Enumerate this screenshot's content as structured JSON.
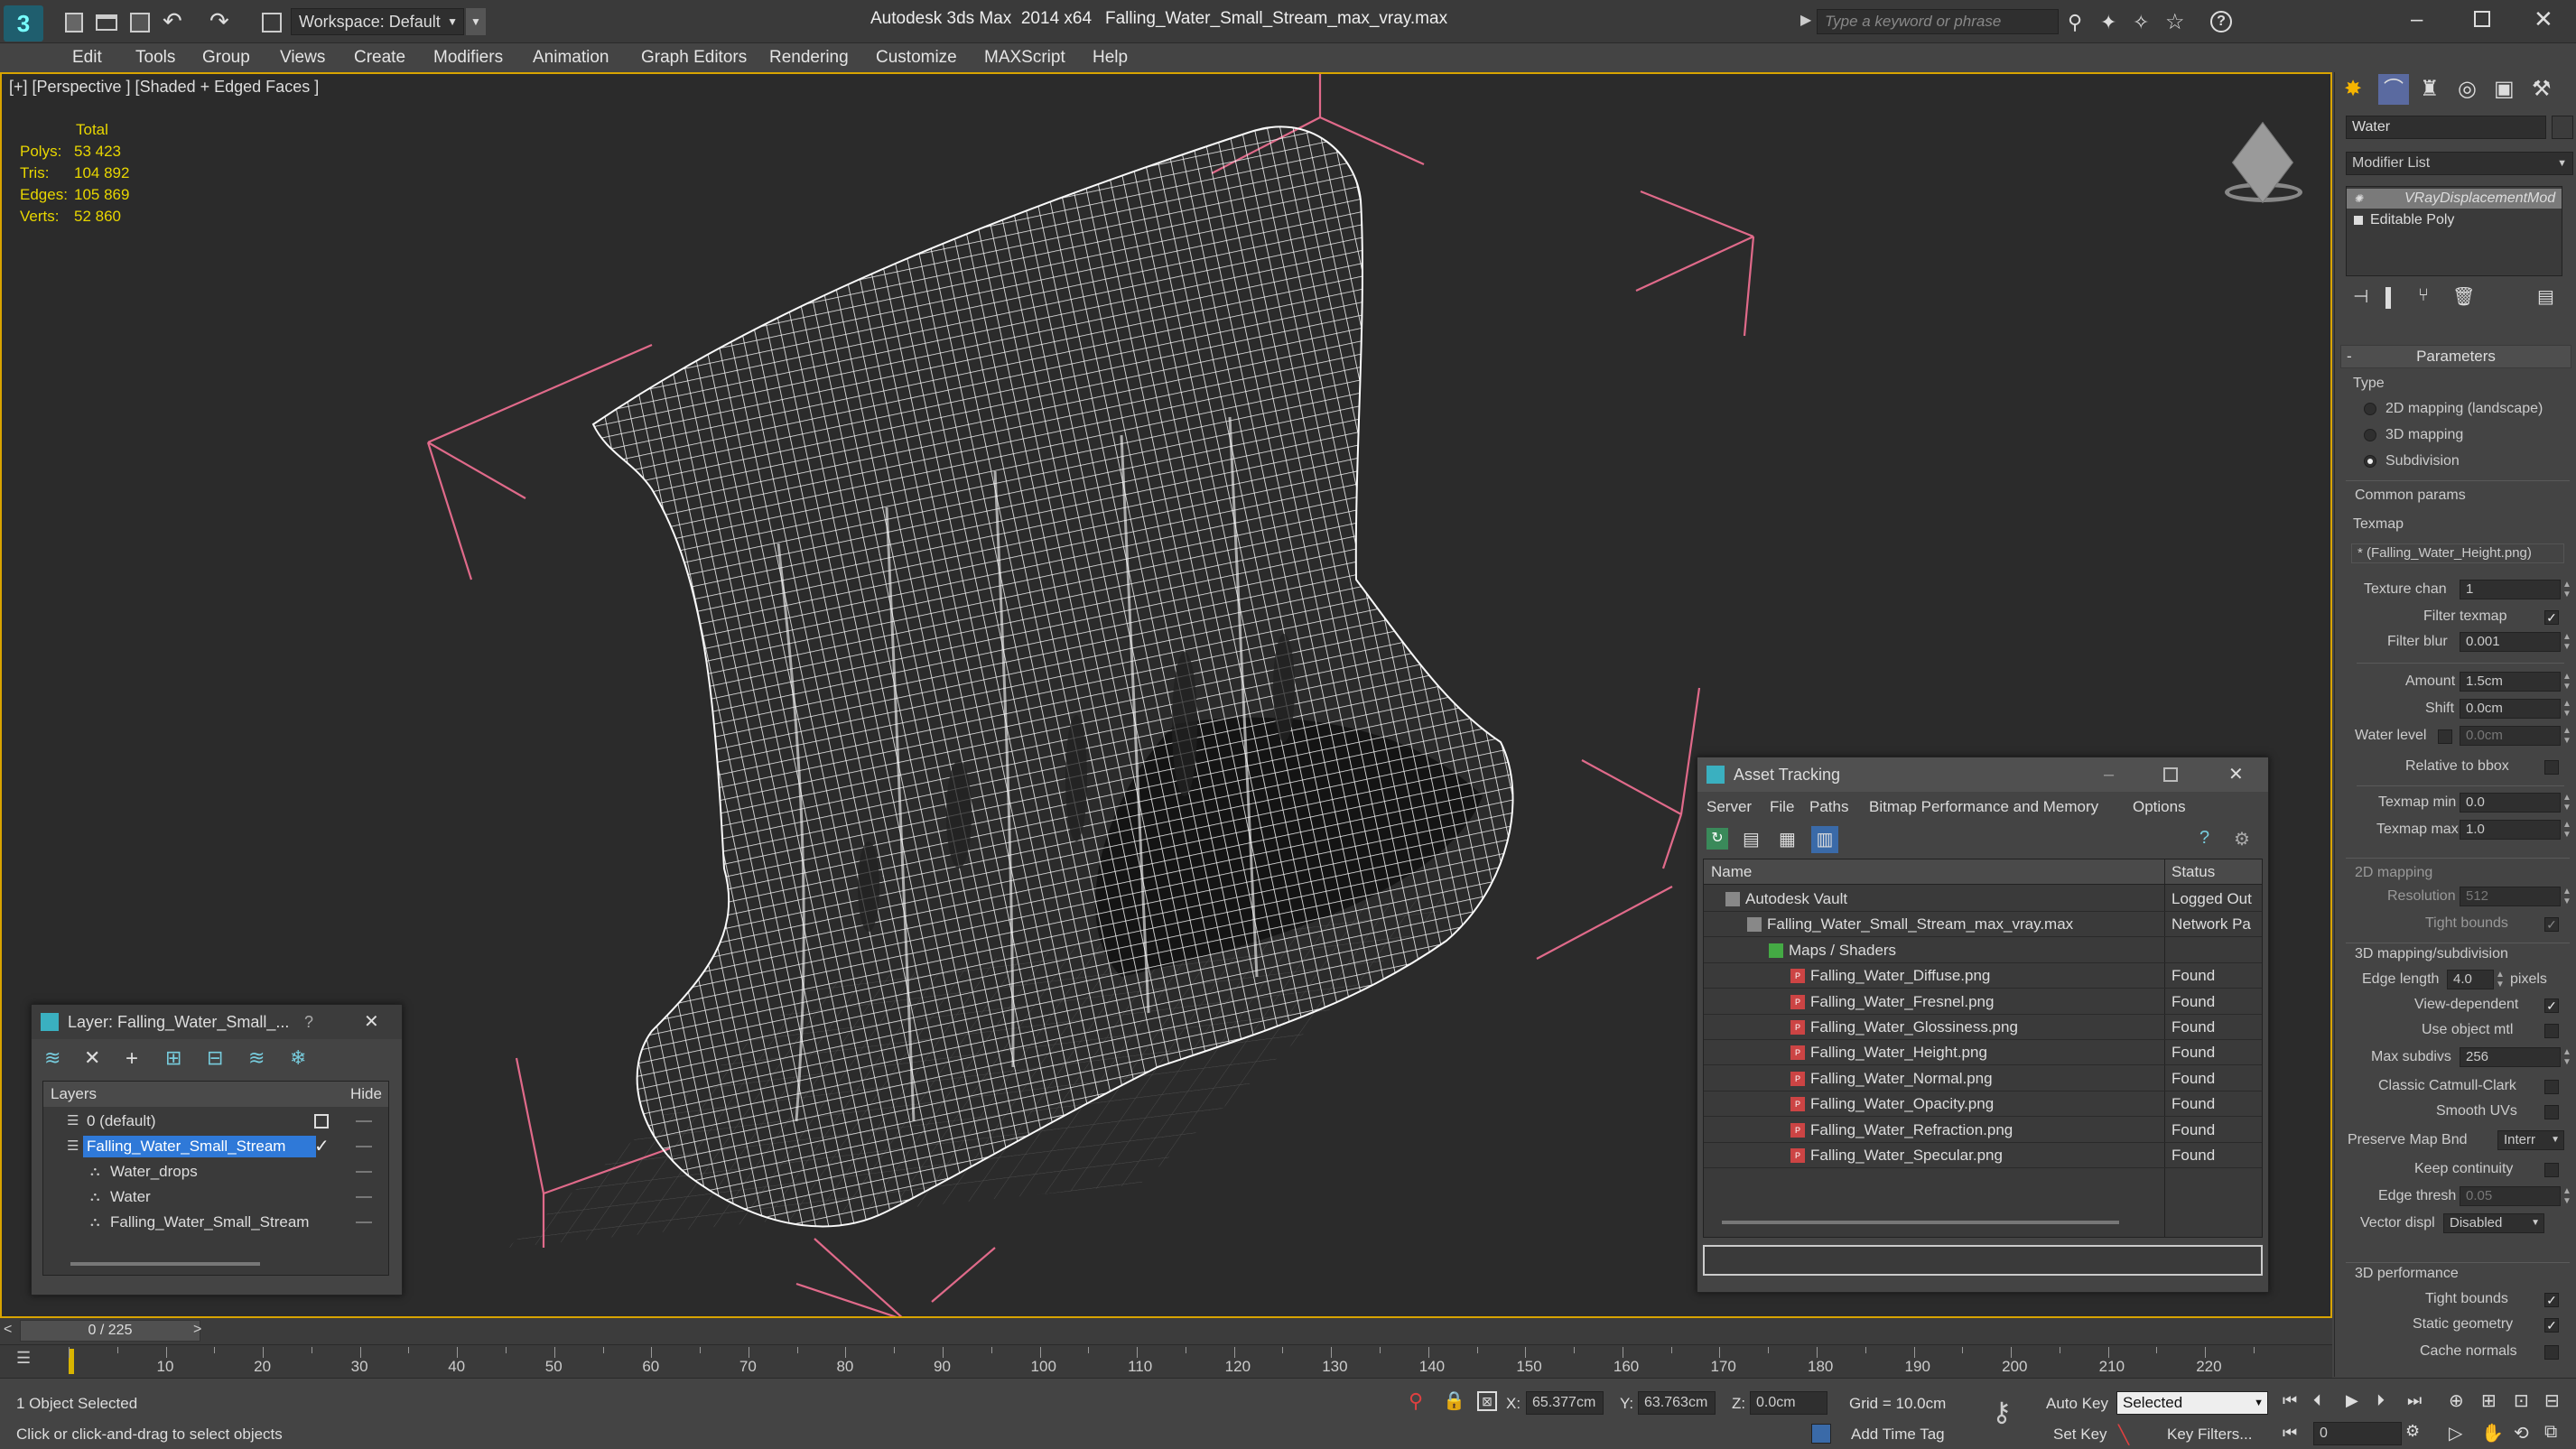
{
  "titlebar": {
    "workspace": "Workspace: Default",
    "app_title": "Autodesk 3ds Max  2014 x64",
    "file_title": "Falling_Water_Small_Stream_max_vray.max",
    "search_placeholder": "Type a keyword or phrase"
  },
  "menu": [
    "Edit",
    "Tools",
    "Group",
    "Views",
    "Create",
    "Modifiers",
    "Animation",
    "Graph Editors",
    "Rendering",
    "Customize",
    "MAXScript",
    "Help"
  ],
  "viewport": {
    "label": "[+] [Perspective ] [Shaded + Edged Faces ]",
    "stats_header": "Total",
    "stats": [
      {
        "k": "Polys:",
        "v": "53 423"
      },
      {
        "k": "Tris:",
        "v": "104 892"
      },
      {
        "k": "Edges:",
        "v": "105 869"
      },
      {
        "k": "Verts:",
        "v": "52 860"
      }
    ]
  },
  "command_panel": {
    "object_name": "Water",
    "modifier_list": "Modifier List",
    "stack": [
      "VRayDisplacementMod",
      "Editable Poly"
    ],
    "rollout_title": "Parameters",
    "type_label": "Type",
    "type_options": [
      {
        "label": "2D mapping (landscape)",
        "on": false
      },
      {
        "label": "3D mapping",
        "on": false
      },
      {
        "label": "Subdivision",
        "on": true
      }
    ],
    "common_params": "Common params",
    "texmap_label": "Texmap",
    "texmap_value": "* (Falling_Water_Height.png)",
    "texture_chan_label": "Texture chan",
    "texture_chan": "1",
    "filter_texmap": "Filter texmap",
    "filter_blur_label": "Filter blur",
    "filter_blur": "0.001",
    "amount_label": "Amount",
    "amount": "1.5cm",
    "shift_label": "Shift",
    "shift": "0.0cm",
    "water_level_label": "Water level",
    "water_level": "0.0cm",
    "relative_bbox": "Relative to bbox",
    "texmap_min_label": "Texmap min",
    "texmap_min": "0.0",
    "texmap_max_label": "Texmap max",
    "texmap_max": "1.0",
    "mapping2d": "2D mapping",
    "resolution_label": "Resolution",
    "resolution": "512",
    "tight_bounds": "Tight bounds",
    "mapping3d": "3D mapping/subdivision",
    "edge_length_label": "Edge length",
    "edge_length": "4.0",
    "pixels": "pixels",
    "view_dependent": "View-dependent",
    "use_object_mtl": "Use object mtl",
    "max_subdivs_label": "Max subdivs",
    "max_subdivs": "256",
    "classic_catmull": "Classic Catmull-Clark",
    "smooth_uvs": "Smooth UVs",
    "preserve_map_label": "Preserve Map Bnd",
    "preserve_map": "Interr",
    "keep_continuity": "Keep continuity",
    "edge_thresh_label": "Edge thresh",
    "edge_thresh": "0.05",
    "vector_displ_label": "Vector displ",
    "vector_displ": "Disabled",
    "perf3d": "3D performance",
    "tight_bounds2": "Tight bounds",
    "static_geometry": "Static geometry",
    "cache_normals": "Cache normals"
  },
  "layer_window": {
    "title": "Layer: Falling_Water_Small_...",
    "help": "?",
    "col_layers": "Layers",
    "col_hide": "Hide",
    "rows": [
      {
        "name": "0 (default)",
        "indent": 0,
        "selected": false
      },
      {
        "name": "Falling_Water_Small_Stream",
        "indent": 0,
        "selected": true
      },
      {
        "name": "Water_drops",
        "indent": 1,
        "selected": false
      },
      {
        "name": "Water",
        "indent": 1,
        "selected": false
      },
      {
        "name": "Falling_Water_Small_Stream",
        "indent": 1,
        "selected": false
      }
    ]
  },
  "asset_window": {
    "title": "Asset Tracking",
    "menu": [
      "Server",
      "File",
      "Paths",
      "Bitmap Performance and Memory",
      "Options"
    ],
    "col_name": "Name",
    "col_status": "Status",
    "rows": [
      {
        "name": "Autodesk Vault",
        "status": "Logged Out",
        "indent": 1
      },
      {
        "name": "Falling_Water_Small_Stream_max_vray.max",
        "status": "Network Pa",
        "indent": 2
      },
      {
        "name": "Maps / Shaders",
        "status": "",
        "indent": 3
      },
      {
        "name": "Falling_Water_Diffuse.png",
        "status": "Found",
        "indent": 4
      },
      {
        "name": "Falling_Water_Fresnel.png",
        "status": "Found",
        "indent": 4
      },
      {
        "name": "Falling_Water_Glossiness.png",
        "status": "Found",
        "indent": 4
      },
      {
        "name": "Falling_Water_Height.png",
        "status": "Found",
        "indent": 4
      },
      {
        "name": "Falling_Water_Normal.png",
        "status": "Found",
        "indent": 4
      },
      {
        "name": "Falling_Water_Opacity.png",
        "status": "Found",
        "indent": 4
      },
      {
        "name": "Falling_Water_Refraction.png",
        "status": "Found",
        "indent": 4
      },
      {
        "name": "Falling_Water_Specular.png",
        "status": "Found",
        "indent": 4
      }
    ]
  },
  "timeline": {
    "frame": "0 / 225",
    "ticks": [
      "10",
      "20",
      "30",
      "40",
      "50",
      "60",
      "70",
      "80",
      "90",
      "100",
      "110",
      "120",
      "130",
      "140",
      "150",
      "160",
      "170",
      "180",
      "190",
      "200",
      "210",
      "220"
    ]
  },
  "status": {
    "selected": "1 Object Selected",
    "prompt": "Click or click-and-drag to select objects",
    "x_label": "X:",
    "x": "65.377cm",
    "y_label": "Y:",
    "y": "63.763cm",
    "z_label": "Z:",
    "z": "0.0cm",
    "grid": "Grid = 10.0cm",
    "auto_key": "Auto Key",
    "selected_dd": "Selected",
    "set_key": "Set Key",
    "key_filters": "Key Filters...",
    "add_time_tag": "Add Time Tag",
    "frame_field": "0"
  }
}
